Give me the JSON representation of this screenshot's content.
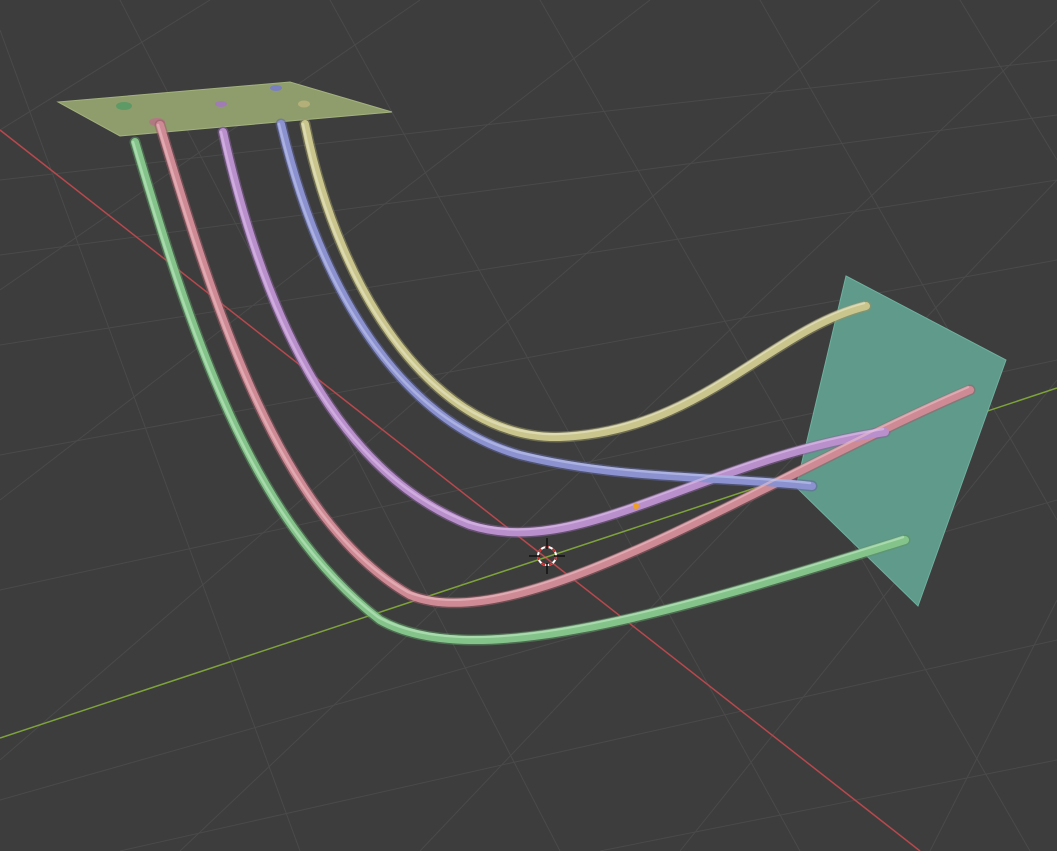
{
  "scene": {
    "background": "#3d3d3d",
    "grid_color": "#4a4a4a",
    "x_axis_color": "#b8484d",
    "y_axis_color": "#7ea33b",
    "top_plate_color": "#8f9d6c",
    "side_plate_color": "#5f9a8a"
  },
  "objects": {
    "top_plate": "plane",
    "side_plate": "plane",
    "origin_point": "object-origin",
    "cursor": "3d-cursor"
  },
  "tubes": [
    {
      "name": "green",
      "color": "#84c48a",
      "dark": "#5d9463"
    },
    {
      "name": "pink",
      "color": "#cf8b95",
      "dark": "#9c5f69"
    },
    {
      "name": "violet",
      "color": "#b98fcc",
      "dark": "#86629a"
    },
    {
      "name": "blue",
      "color": "#8b92cf",
      "dark": "#61679b"
    },
    {
      "name": "yellow",
      "color": "#c9c58c",
      "dark": "#969262"
    }
  ]
}
